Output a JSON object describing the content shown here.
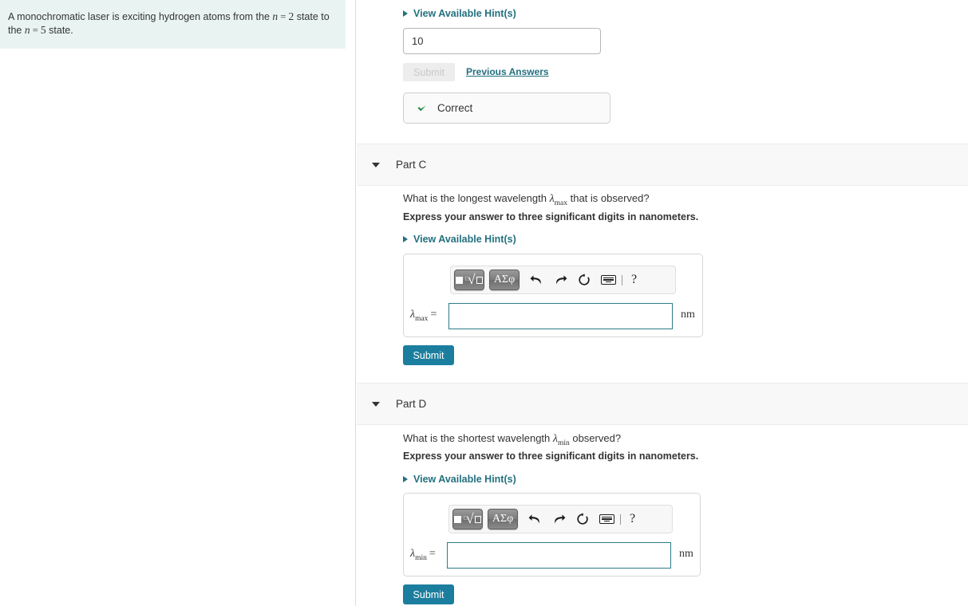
{
  "problem": {
    "text_before_var1": "A monochromatic laser is exciting hydrogen atoms from the ",
    "var1": "n",
    "eq1": " = ",
    "val1": "2",
    "text_middle": " state to the ",
    "var2": "n",
    "eq2": " = ",
    "val2": "5",
    "text_after": " state."
  },
  "part_b_tail": {
    "hint_label": "View Available Hint(s)",
    "answer_value": "10",
    "submit_label": "Submit",
    "previous_answers_label": "Previous Answers",
    "feedback_label": "Correct"
  },
  "part_c": {
    "title": "Part C",
    "question_prefix": "What is the longest wavelength ",
    "question_symbol": "λ",
    "question_subscript": "max",
    "question_suffix": " that is observed?",
    "instruction": "Express your answer to three significant digits in nanometers.",
    "hint_label": "View Available Hint(s)",
    "var_symbol": "λ",
    "var_subscript": "max",
    "equals": "=",
    "answer_value": "",
    "answer_placeholder": "",
    "unit": "nm",
    "submit_label": "Submit",
    "toolbar": {
      "template_button_label": "math-template",
      "greek_button_label": "ΑΣφ",
      "undo_label": "undo",
      "redo_label": "redo",
      "reset_label": "reset",
      "keyboard_label": "keyboard-shortcuts",
      "help_label": "?"
    }
  },
  "part_d": {
    "title": "Part D",
    "question_prefix": "What is the shortest wavelength ",
    "question_symbol": "λ",
    "question_subscript": "min",
    "question_suffix": " observed?",
    "instruction": "Express your answer to three significant digits in nanometers.",
    "hint_label": "View Available Hint(s)",
    "var_symbol": "λ",
    "var_subscript": "min",
    "equals": "=",
    "answer_value": "",
    "answer_placeholder": "",
    "unit": "nm",
    "submit_label": "Submit",
    "toolbar": {
      "template_button_label": "math-template",
      "greek_button_label": "ΑΣφ",
      "undo_label": "undo",
      "redo_label": "redo",
      "reset_label": "reset",
      "keyboard_label": "keyboard-shortcuts",
      "help_label": "?"
    }
  },
  "colors": {
    "link_teal": "#23707f",
    "submit_blue": "#1c7e9e",
    "correct_green": "#138138",
    "problem_bg": "#e9f4f2",
    "header_band": "#f8f8f8",
    "input_border_teal": "#2f7a88"
  }
}
